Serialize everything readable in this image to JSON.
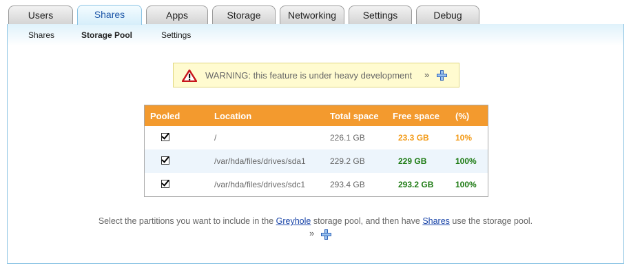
{
  "tabs": [
    "Users",
    "Shares",
    "Apps",
    "Storage",
    "Networking",
    "Settings",
    "Debug"
  ],
  "active_tab": "Shares",
  "subnav": [
    "Shares",
    "Storage Pool",
    "Settings"
  ],
  "active_subnav": "Storage Pool",
  "warning": {
    "text": "WARNING: this feature is under heavy development",
    "chevron": "»"
  },
  "table": {
    "headers": [
      "Pooled",
      "Location",
      "Total space",
      "Free space",
      "(%)"
    ],
    "rows": [
      {
        "pooled": true,
        "location": "/",
        "total": "226.1 GB",
        "free": "23.3 GB",
        "pct": "10%",
        "status": "warn"
      },
      {
        "pooled": true,
        "location": "/var/hda/files/drives/sda1",
        "total": "229.2 GB",
        "free": "229 GB",
        "pct": "100%",
        "status": "ok"
      },
      {
        "pooled": true,
        "location": "/var/hda/files/drives/sdc1",
        "total": "293.4 GB",
        "free": "293.2 GB",
        "pct": "100%",
        "status": "ok"
      }
    ]
  },
  "footer": {
    "part1": "Select the partitions you want to include in the ",
    "link1": "Greyhole",
    "part2": " storage pool, and then have ",
    "link2": "Shares",
    "part3": " use the storage pool.",
    "chevron": "»"
  },
  "colors": {
    "accent_blue": "#8cc4e4",
    "header_orange": "#f39a2e",
    "free_warn": "#f39a16",
    "free_ok": "#1c7a12"
  }
}
